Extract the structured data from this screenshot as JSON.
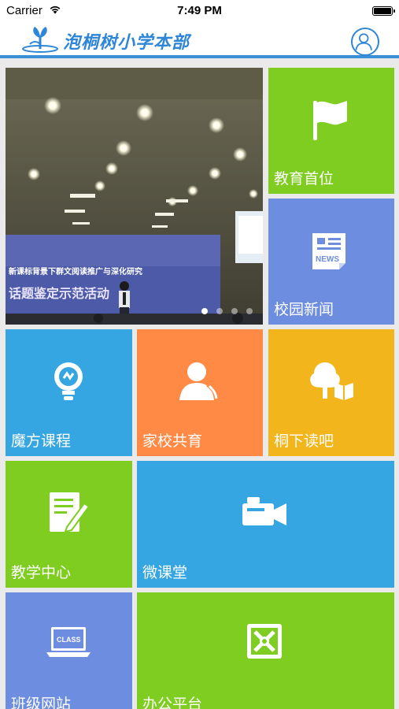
{
  "status_bar": {
    "carrier": "Carrier",
    "time": "7:49 PM"
  },
  "nav": {
    "title": "泡桐树小学本部"
  },
  "banner": {
    "slide_count": 4,
    "active_slide": 0,
    "stage_text_1": "新课标背景下群文阅读推广与深化研究",
    "stage_text_2": "话题鉴定示范活动"
  },
  "tiles": {
    "education": {
      "label": "教育首位",
      "color": "#7ecd20",
      "icon": "flag-icon"
    },
    "news": {
      "label": "校园新闻",
      "color": "#6d8ee0",
      "icon": "news-icon",
      "icon_text": "NEWS"
    },
    "course": {
      "label": "魔方课程",
      "color": "#36a6e2",
      "icon": "lightbulb-icon"
    },
    "home_school": {
      "label": "家校共育",
      "color": "#ff8a46",
      "icon": "person-phone-icon"
    },
    "reading": {
      "label": "桐下读吧",
      "color": "#f2b51b",
      "icon": "tree-book-icon"
    },
    "teaching": {
      "label": "教学中心",
      "color": "#7ecd20",
      "icon": "document-pen-icon"
    },
    "micro_class": {
      "label": "微课堂",
      "color": "#36a6e2",
      "icon": "video-camera-icon"
    },
    "class_site": {
      "label": "班级网站",
      "color": "#6d8ee0",
      "icon": "laptop-icon",
      "icon_text": "CLASS"
    },
    "office": {
      "label": "办公平台",
      "color": "#7ecd20",
      "icon": "office-platform-icon"
    }
  }
}
